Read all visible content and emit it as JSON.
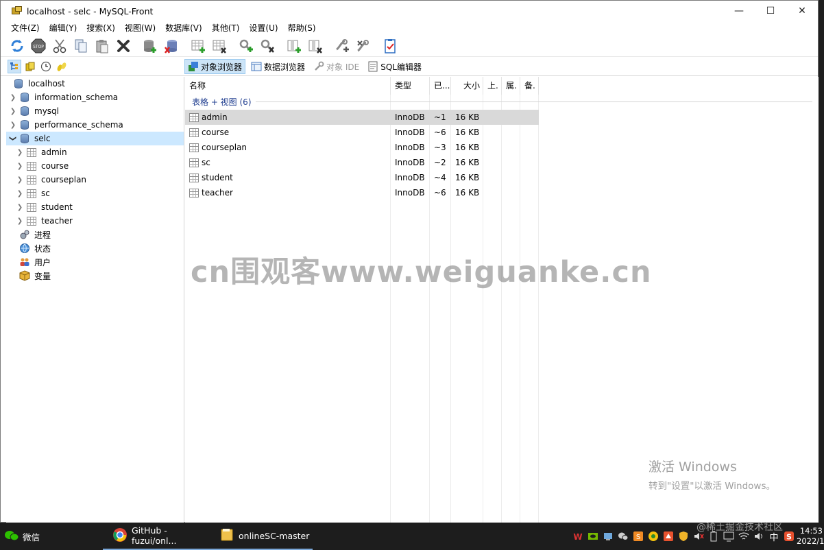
{
  "window": {
    "title": "localhost - selc - MySQL-Front",
    "controls": {
      "minimize": "—",
      "maximize": "☐",
      "close": "✕"
    }
  },
  "menu": [
    "文件(Z)",
    "编辑(Y)",
    "搜索(X)",
    "视图(W)",
    "数据库(V)",
    "其他(T)",
    "设置(U)",
    "帮助(S)"
  ],
  "toolbar": {
    "icons": [
      "refresh-icon",
      "stop-icon",
      "cut-icon",
      "copy-icon",
      "paste-icon",
      "delete-icon",
      "database-add-icon",
      "database-delete-icon",
      "table-add-icon",
      "table-delete-icon",
      "index-add-icon",
      "index-delete-icon",
      "field-add-icon",
      "field-delete-icon",
      "foreign-key-add-icon",
      "foreign-key-delete-icon",
      "checklist-icon"
    ]
  },
  "views": {
    "object_browser": "对象浏览器",
    "data_browser": "数据浏览器",
    "object_ide": "对象 IDE",
    "sql_editor": "SQL编辑器"
  },
  "tree": {
    "root": "localhost",
    "databases": [
      "information_schema",
      "mysql",
      "performance_schema",
      "selc"
    ],
    "selc_tables": [
      "admin",
      "course",
      "courseplan",
      "sc",
      "student",
      "teacher"
    ],
    "extras": [
      "进程",
      "状态",
      "用户",
      "变量"
    ]
  },
  "grid": {
    "columns": [
      "名称",
      "类型",
      "已...",
      "大小",
      "上.",
      "属.",
      "备."
    ],
    "group_label": "表格 + 视图 (6)",
    "rows": [
      {
        "name": "admin",
        "type": "InnoDB",
        "records": "~1",
        "size": "16 KB"
      },
      {
        "name": "course",
        "type": "InnoDB",
        "records": "~6",
        "size": "16 KB"
      },
      {
        "name": "courseplan",
        "type": "InnoDB",
        "records": "~3",
        "size": "16 KB"
      },
      {
        "name": "sc",
        "type": "InnoDB",
        "records": "~2",
        "size": "16 KB"
      },
      {
        "name": "student",
        "type": "InnoDB",
        "records": "~4",
        "size": "16 KB"
      },
      {
        "name": "teacher",
        "type": "InnoDB",
        "records": "~6",
        "size": "16 KB"
      }
    ]
  },
  "watermark": "cn围观客www.weiguanke.cn",
  "activation": {
    "line1": "激活 Windows",
    "line2": "转到\"设置\"以激活 Windows。"
  },
  "taskbar": {
    "wechat": "微信",
    "chrome": "GitHub - fuzui/onl...",
    "folder": "onlineSC-master",
    "ime": "中",
    "time": "14:53",
    "date": "2022/1",
    "overlay": "@稀土掘金技术社区"
  },
  "colors": {
    "selection": "#cce8ff",
    "row_selected": "#d9d9d9",
    "group_label": "#1f3d8f",
    "taskbar": "#1d1d1d"
  }
}
